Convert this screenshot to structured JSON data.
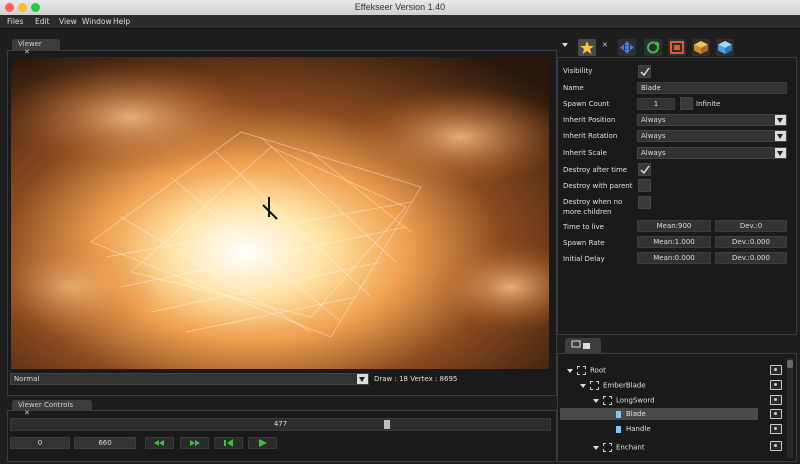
{
  "window": {
    "title": "Effekseer Version 1.40"
  },
  "menu": [
    "Files",
    "Edit",
    "View",
    "Window",
    "Help"
  ],
  "viewer": {
    "tab_label": "Viewer",
    "close_glyph": "✕",
    "render_mode": "Normal",
    "stats": "Draw : 18 Vertex : 8695"
  },
  "viewer_controls": {
    "tab_label": "Viewer Controls",
    "close_glyph": "✕",
    "current_frame": "477",
    "progress_fraction": 0.7,
    "start_frame": "0",
    "end_frame": "660"
  },
  "properties": {
    "rows": [
      {
        "label": "Visibility"
      },
      {
        "label": "Name",
        "value": "Blade"
      },
      {
        "label": "Spawn Count",
        "value": "1",
        "extra": "Infinite"
      },
      {
        "label": "Inherit Position",
        "value": "Always"
      },
      {
        "label": "Inherit Rotation",
        "value": "Always"
      },
      {
        "label": "Inherit Scale",
        "value": "Always"
      },
      {
        "label": "Destroy after time"
      },
      {
        "label": "Destroy with parent"
      },
      {
        "label": "Destroy when no"
      },
      {
        "label": "more children"
      },
      {
        "label": "Time to live",
        "mean": "Mean:900",
        "dev": "Dev.:0"
      },
      {
        "label": "Spawn Rate",
        "mean": "Mean:1.000",
        "dev": "Dev.:0.000"
      },
      {
        "label": "Initial Delay",
        "mean": "Mean:0.000",
        "dev": "Dev.:0.000"
      }
    ],
    "tab_icons": [
      "star-icon",
      "move-icon",
      "rotate-icon",
      "scale-icon",
      "box-icon",
      "cube-icon"
    ],
    "close_glyph": "✕"
  },
  "node_tree": {
    "items": [
      "Root",
      "EmberBlade",
      "LongSword",
      "Blade",
      "Handle",
      "Enchant"
    ]
  },
  "colors": {
    "accent": "#4a90d9",
    "checkbox_bg": "#3a3a3a",
    "play_green": "#3fbf3f"
  }
}
